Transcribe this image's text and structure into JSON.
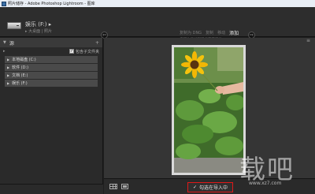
{
  "window": {
    "title": "照片储存 - Adobe Photoshop Lightroom - 图库"
  },
  "header": {
    "source_name": "娱乐 (F:) ▸",
    "source_path": "▸ 大桌面 | 照片",
    "modes": [
      "复制为 DNG",
      "复制",
      "移动",
      "添加"
    ],
    "active_mode": "添加",
    "mode_description": "将照片添加到目录而不移动"
  },
  "left_panel": {
    "title": "源",
    "add_symbol": "+",
    "include_subfolders_label": "包含子文件夹",
    "include_subfolders_checked": true,
    "folders": [
      {
        "label": "本地磁盘 (C:)"
      },
      {
        "label": "软件 (D:)"
      },
      {
        "label": "文档 (E:)"
      },
      {
        "label": "娱乐 (F:)"
      }
    ]
  },
  "grid": {
    "top_right_symbol": "≡"
  },
  "bottom_bar": {
    "checked_label": "勾选在导入中",
    "checked_mark": "✓"
  },
  "watermark": {
    "text": "载吧",
    "url": "www.xz7.com"
  },
  "colors": {
    "highlight_border": "#e01818",
    "panel_bg": "#2a2a2a",
    "grid_bg": "#353535"
  }
}
